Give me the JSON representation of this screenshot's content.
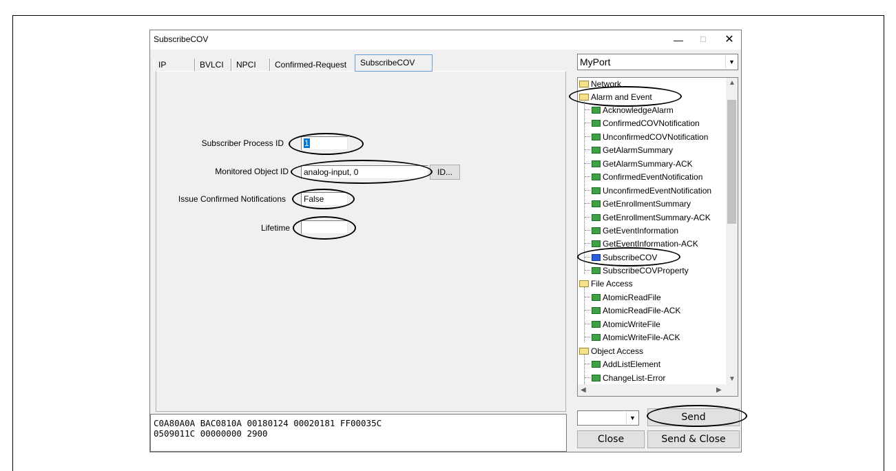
{
  "window": {
    "title": "SubscribeCOV",
    "minimize_glyph": "—",
    "maximize_glyph": "☐",
    "close_glyph": "✕"
  },
  "tabs": [
    {
      "label": "IP"
    },
    {
      "label": "BVLCI"
    },
    {
      "label": "NPCI"
    },
    {
      "label": "Confirmed-Request"
    },
    {
      "label": "SubscribeCOV",
      "active": true
    }
  ],
  "form": {
    "subscriber_process_id": {
      "label": "Subscriber Process ID",
      "value": "1"
    },
    "monitored_object_id": {
      "label": "Monitored Object ID",
      "value": "analog-input, 0",
      "button_label": "ID..."
    },
    "issue_confirmed_notifications": {
      "label": "Issue Confirmed Notifications",
      "value": "False"
    },
    "lifetime": {
      "label": "Lifetime",
      "value": ""
    }
  },
  "hex": {
    "line1": "C0A80A0A BAC0810A 00180124 00020181 FF00035C",
    "line2": "0509011C 00000000 2900"
  },
  "port_select": {
    "value": "MyPort"
  },
  "tree": {
    "network": "Network",
    "alarm_and_event": "Alarm and Event",
    "items_alarm": [
      "AcknowledgeAlarm",
      "ConfirmedCOVNotification",
      "UnconfirmedCOVNotification",
      "GetAlarmSummary",
      "GetAlarmSummary-ACK",
      "ConfirmedEventNotification",
      "UnconfirmedEventNotification",
      "GetEnrollmentSummary",
      "GetEnrollmentSummary-ACK",
      "GetEventInformation",
      "GetEventInformation-ACK",
      "SubscribeCOV",
      "SubscribeCOVProperty"
    ],
    "file_access": "File Access",
    "items_file": [
      "AtomicReadFile",
      "AtomicReadFile-ACK",
      "AtomicWriteFile",
      "AtomicWriteFile-ACK"
    ],
    "object_access": "Object Access",
    "items_object": [
      "AddListElement",
      "ChangeList-Error"
    ],
    "selected": "SubscribeCOV"
  },
  "buttons": {
    "send": "Send",
    "close": "Close",
    "send_close": "Send & Close"
  }
}
